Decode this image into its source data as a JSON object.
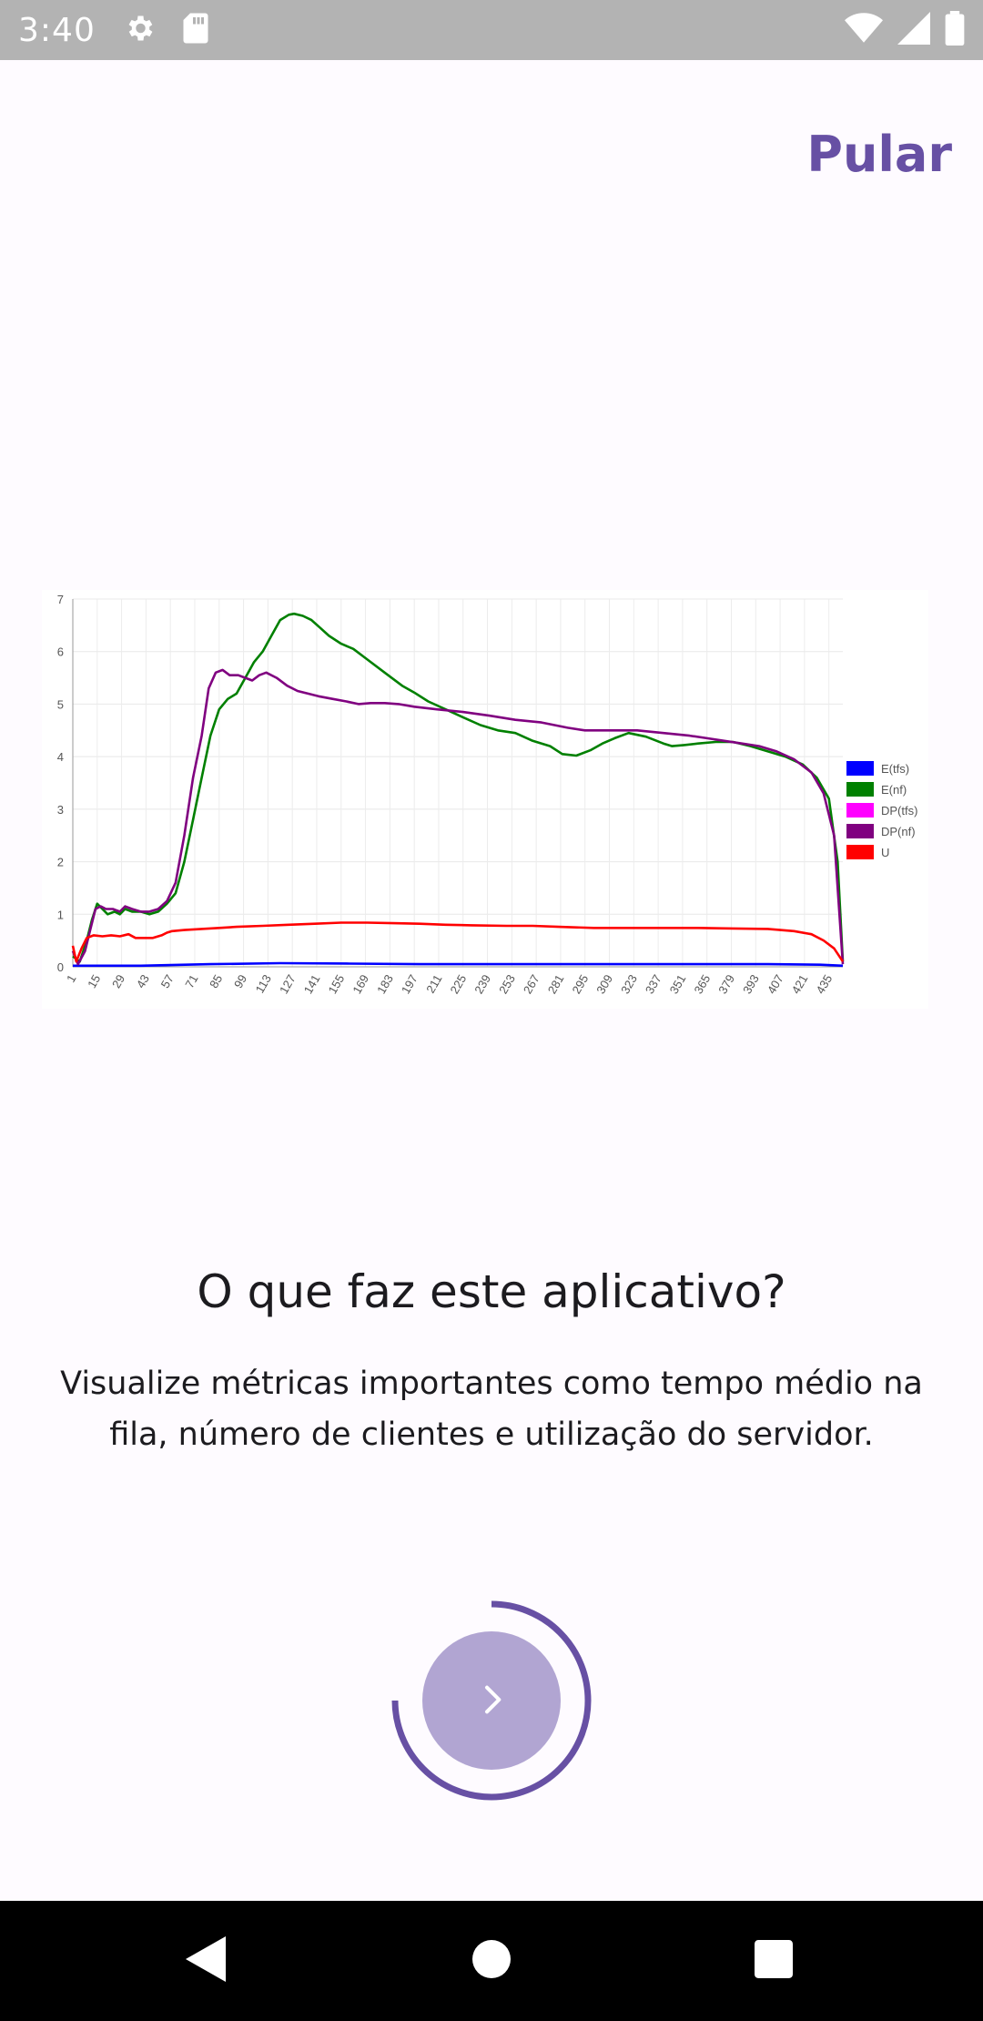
{
  "status_bar": {
    "time": "3:40",
    "left_icons": [
      "settings-icon",
      "sd-card-icon"
    ],
    "right_icons": [
      "wifi-icon",
      "signal-icon",
      "battery-icon"
    ]
  },
  "header": {
    "skip_label": "Pular"
  },
  "chart_data": {
    "type": "line",
    "ylim": [
      0,
      7
    ],
    "yticks": [
      "0",
      "1",
      "2",
      "3",
      "4",
      "5",
      "6",
      "7"
    ],
    "xticks": [
      "1",
      "15",
      "29",
      "43",
      "57",
      "71",
      "85",
      "99",
      "113",
      "127",
      "141",
      "155",
      "169",
      "183",
      "197",
      "211",
      "225",
      "239",
      "253",
      "267",
      "281",
      "295",
      "309",
      "323",
      "337",
      "351",
      "365",
      "379",
      "393",
      "407",
      "421",
      "435"
    ],
    "xlim": [
      1,
      443
    ],
    "grid": true,
    "legend_position": "right",
    "series": [
      {
        "name": "E(tfs)",
        "color": "#0000ff",
        "points": [
          [
            1,
            0.02
          ],
          [
            40,
            0.02
          ],
          [
            80,
            0.05
          ],
          [
            120,
            0.07
          ],
          [
            160,
            0.06
          ],
          [
            200,
            0.05
          ],
          [
            250,
            0.05
          ],
          [
            300,
            0.05
          ],
          [
            350,
            0.05
          ],
          [
            400,
            0.05
          ],
          [
            430,
            0.04
          ],
          [
            443,
            0.02
          ]
        ]
      },
      {
        "name": "E(nf)",
        "color": "#008000",
        "points": [
          [
            1,
            0.2
          ],
          [
            5,
            0.1
          ],
          [
            9,
            0.5
          ],
          [
            12,
            0.9
          ],
          [
            15,
            1.2
          ],
          [
            18,
            1.1
          ],
          [
            21,
            1.0
          ],
          [
            25,
            1.05
          ],
          [
            28,
            1.0
          ],
          [
            31,
            1.1
          ],
          [
            35,
            1.05
          ],
          [
            40,
            1.05
          ],
          [
            45,
            1.0
          ],
          [
            50,
            1.05
          ],
          [
            55,
            1.2
          ],
          [
            60,
            1.4
          ],
          [
            65,
            2.0
          ],
          [
            70,
            2.8
          ],
          [
            75,
            3.6
          ],
          [
            80,
            4.4
          ],
          [
            85,
            4.9
          ],
          [
            90,
            5.1
          ],
          [
            95,
            5.2
          ],
          [
            100,
            5.5
          ],
          [
            105,
            5.8
          ],
          [
            110,
            6.0
          ],
          [
            115,
            6.3
          ],
          [
            120,
            6.6
          ],
          [
            125,
            6.7
          ],
          [
            128,
            6.72
          ],
          [
            133,
            6.68
          ],
          [
            138,
            6.6
          ],
          [
            143,
            6.45
          ],
          [
            148,
            6.3
          ],
          [
            155,
            6.15
          ],
          [
            162,
            6.05
          ],
          [
            170,
            5.85
          ],
          [
            180,
            5.6
          ],
          [
            190,
            5.35
          ],
          [
            197,
            5.22
          ],
          [
            205,
            5.05
          ],
          [
            215,
            4.9
          ],
          [
            225,
            4.75
          ],
          [
            235,
            4.6
          ],
          [
            245,
            4.5
          ],
          [
            255,
            4.45
          ],
          [
            265,
            4.3
          ],
          [
            275,
            4.2
          ],
          [
            282,
            4.05
          ],
          [
            290,
            4.02
          ],
          [
            298,
            4.12
          ],
          [
            305,
            4.25
          ],
          [
            312,
            4.35
          ],
          [
            320,
            4.45
          ],
          [
            330,
            4.38
          ],
          [
            340,
            4.25
          ],
          [
            345,
            4.2
          ],
          [
            352,
            4.22
          ],
          [
            360,
            4.25
          ],
          [
            370,
            4.28
          ],
          [
            380,
            4.28
          ],
          [
            390,
            4.2
          ],
          [
            400,
            4.1
          ],
          [
            410,
            4.0
          ],
          [
            420,
            3.85
          ],
          [
            428,
            3.6
          ],
          [
            435,
            3.2
          ],
          [
            440,
            2.0
          ],
          [
            443,
            0.1
          ]
        ]
      },
      {
        "name": "DP(tfs)",
        "color": "#ff00ff",
        "points": []
      },
      {
        "name": "DP(nf)",
        "color": "#800080",
        "points": [
          [
            1,
            0.3
          ],
          [
            4,
            0.05
          ],
          [
            8,
            0.3
          ],
          [
            11,
            0.7
          ],
          [
            14,
            1.1
          ],
          [
            17,
            1.15
          ],
          [
            20,
            1.1
          ],
          [
            24,
            1.1
          ],
          [
            28,
            1.05
          ],
          [
            31,
            1.15
          ],
          [
            35,
            1.1
          ],
          [
            40,
            1.05
          ],
          [
            45,
            1.05
          ],
          [
            50,
            1.1
          ],
          [
            55,
            1.25
          ],
          [
            60,
            1.6
          ],
          [
            65,
            2.5
          ],
          [
            70,
            3.6
          ],
          [
            75,
            4.4
          ],
          [
            79,
            5.3
          ],
          [
            83,
            5.6
          ],
          [
            87,
            5.65
          ],
          [
            91,
            5.55
          ],
          [
            96,
            5.55
          ],
          [
            100,
            5.5
          ],
          [
            104,
            5.45
          ],
          [
            108,
            5.55
          ],
          [
            112,
            5.6
          ],
          [
            118,
            5.5
          ],
          [
            124,
            5.35
          ],
          [
            130,
            5.25
          ],
          [
            136,
            5.2
          ],
          [
            142,
            5.15
          ],
          [
            150,
            5.1
          ],
          [
            158,
            5.05
          ],
          [
            165,
            5.0
          ],
          [
            172,
            5.02
          ],
          [
            180,
            5.02
          ],
          [
            188,
            5.0
          ],
          [
            197,
            4.95
          ],
          [
            210,
            4.9
          ],
          [
            225,
            4.85
          ],
          [
            240,
            4.78
          ],
          [
            255,
            4.7
          ],
          [
            270,
            4.65
          ],
          [
            285,
            4.55
          ],
          [
            295,
            4.5
          ],
          [
            310,
            4.5
          ],
          [
            325,
            4.5
          ],
          [
            340,
            4.45
          ],
          [
            355,
            4.4
          ],
          [
            365,
            4.35
          ],
          [
            375,
            4.3
          ],
          [
            385,
            4.25
          ],
          [
            395,
            4.2
          ],
          [
            405,
            4.1
          ],
          [
            415,
            3.95
          ],
          [
            425,
            3.7
          ],
          [
            432,
            3.3
          ],
          [
            438,
            2.5
          ],
          [
            443,
            0.05
          ]
        ]
      },
      {
        "name": "U",
        "color": "#ff0000",
        "points": [
          [
            1,
            0.4
          ],
          [
            3,
            0.1
          ],
          [
            6,
            0.35
          ],
          [
            9,
            0.55
          ],
          [
            13,
            0.6
          ],
          [
            18,
            0.58
          ],
          [
            23,
            0.6
          ],
          [
            28,
            0.58
          ],
          [
            33,
            0.62
          ],
          [
            37,
            0.55
          ],
          [
            42,
            0.55
          ],
          [
            47,
            0.55
          ],
          [
            52,
            0.6
          ],
          [
            55,
            0.65
          ],
          [
            58,
            0.68
          ],
          [
            65,
            0.7
          ],
          [
            75,
            0.72
          ],
          [
            85,
            0.74
          ],
          [
            95,
            0.76
          ],
          [
            110,
            0.78
          ],
          [
            125,
            0.8
          ],
          [
            140,
            0.82
          ],
          [
            155,
            0.84
          ],
          [
            170,
            0.84
          ],
          [
            185,
            0.83
          ],
          [
            200,
            0.82
          ],
          [
            215,
            0.8
          ],
          [
            230,
            0.79
          ],
          [
            250,
            0.78
          ],
          [
            265,
            0.78
          ],
          [
            280,
            0.76
          ],
          [
            300,
            0.74
          ],
          [
            320,
            0.74
          ],
          [
            340,
            0.74
          ],
          [
            360,
            0.74
          ],
          [
            380,
            0.73
          ],
          [
            400,
            0.72
          ],
          [
            415,
            0.68
          ],
          [
            425,
            0.62
          ],
          [
            432,
            0.5
          ],
          [
            438,
            0.35
          ],
          [
            443,
            0.1
          ]
        ]
      }
    ]
  },
  "content": {
    "title": "O que faz este aplicativo?",
    "description": "Visualize métricas importantes como tempo médio na fila, número de clientes e utilização do servidor."
  },
  "next_button": {
    "icon": "chevron-right-icon",
    "progress": 0.75,
    "accent": "#6750a4",
    "fill": "#b1a5d2"
  },
  "nav_bar": {
    "icons": [
      "back-icon",
      "home-icon",
      "recents-icon"
    ]
  }
}
